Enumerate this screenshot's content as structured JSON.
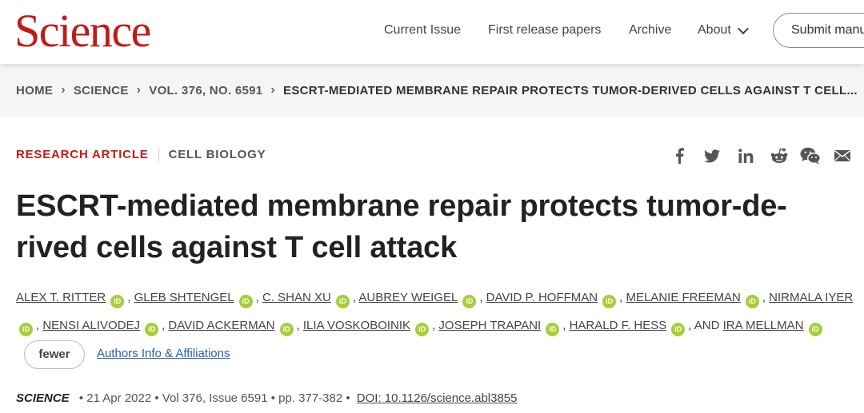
{
  "header": {
    "logo": "Science",
    "nav": [
      "Current Issue",
      "First release papers",
      "Archive",
      "About"
    ],
    "submit_label": "Submit manu"
  },
  "breadcrumb": [
    "HOME",
    "SCIENCE",
    "VOL. 376, NO. 6591",
    "ESCRT-MEDIATED MEMBRANE REPAIR PROTECTS TUMOR-DERIVED CELLS AGAINST T CELL..."
  ],
  "article": {
    "type": "RESEARCH ARTICLE",
    "subject": "CELL BIOLOGY",
    "title_line1": "ESCRT-mediated membrane repair protects tumor-de-",
    "title_line2": "rived cells against T cell attack",
    "orcid_label": "iD",
    "authors_row1": [
      "ALEX T. RITTER",
      "GLEB SHTENGEL",
      "C. SHAN XU",
      "AUBREY WEIGEL",
      "DAVID P. HOFFMAN",
      "MELANIE FREEMAN",
      "NIRMALA IYER"
    ],
    "authors_row2": [
      "NENSI ALIVODEJ",
      "DAVID ACKERMAN",
      "ILIA VOSKOBOINIK",
      "JOSEPH TRAPANI",
      "HARALD F. HESS"
    ],
    "and_label": "AND",
    "last_author": "IRA MELLMAN",
    "fewer_label": "fewer",
    "affiliations_link": "Authors Info & Affiliations",
    "journal": "SCIENCE",
    "citation": "• 21 Apr 2022 • Vol 376, Issue 6591 • pp. 377-382 •",
    "doi": "DOI: 10.1126/science.abl3855"
  },
  "share_icons": [
    "facebook-icon",
    "twitter-icon",
    "linkedin-icon",
    "reddit-icon",
    "wechat-icon",
    "email-icon"
  ],
  "colors": {
    "brand_red": "#c41a16",
    "orcid_green": "#a6ce39",
    "link_blue": "#2a5db0"
  }
}
